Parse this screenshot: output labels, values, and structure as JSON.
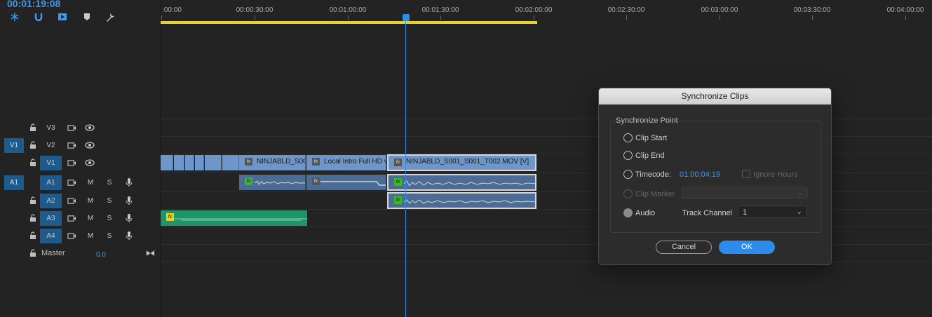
{
  "timecode": "00:01:19:08",
  "toolbar": {
    "tools": [
      "insert-snap-icon",
      "magnet-icon",
      "linked-selection-icon",
      "marker-icon",
      "wrench-icon"
    ]
  },
  "ruler": {
    "labels": [
      ":00:00",
      "00:00:30:00",
      "00:01:00:00",
      "00:01:30:00",
      "00:02:00:00",
      "00:02:30:00",
      "00:03:00:00",
      "00:03:30:00",
      "00:04:00:00"
    ]
  },
  "tracks": [
    {
      "patch": "",
      "label": "V3",
      "type": "video"
    },
    {
      "patch": "V1",
      "label": "V2",
      "type": "video"
    },
    {
      "patch": "",
      "label": "V1",
      "type": "video"
    },
    {
      "patch": "A1",
      "label": "A1",
      "type": "audio"
    },
    {
      "patch": "",
      "label": "A2",
      "type": "audio"
    },
    {
      "patch": "",
      "label": "A3",
      "type": "audio"
    },
    {
      "patch": "",
      "label": "A4",
      "type": "audio"
    }
  ],
  "audio_buttons": {
    "mute": "M",
    "solo": "S"
  },
  "master": {
    "label": "Master",
    "value": "0.0"
  },
  "clips": {
    "fx": "fx",
    "v1_clip1": "NINJABLD_S00",
    "v1_clip2": "Local Intro Full HD v",
    "v1_clip3": "NINJABLD_S001_S001_T002.MOV [V]"
  },
  "dialog": {
    "title": "Synchronize Clips",
    "group_title": "Synchronize Point",
    "options": {
      "clip_start": "Clip Start",
      "clip_end": "Clip End",
      "timecode": "Timecode:",
      "clip_marker": "Clip Marker",
      "audio": "Audio"
    },
    "timecode_value": "01:00:04:19",
    "ignore_hours": "Ignore Hours",
    "track_channel_label": "Track Channel",
    "track_channel_value": "1",
    "cancel": "Cancel",
    "ok": "OK"
  },
  "colors": {
    "accent": "#2d8ceb",
    "work_area": "#e6d32a",
    "video_clip": "#6f96c9",
    "audio_clip": "#4d6c93",
    "green_clip": "#1f9466"
  }
}
